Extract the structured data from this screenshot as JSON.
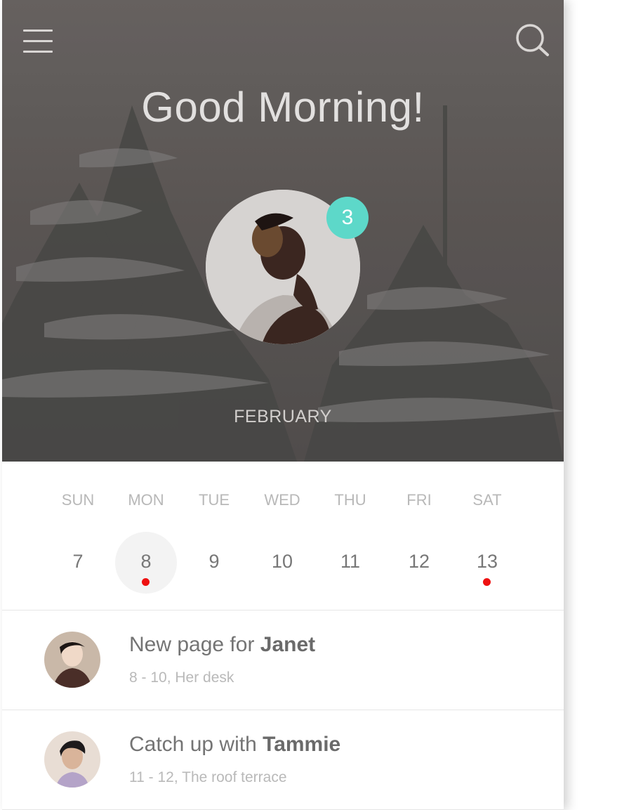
{
  "header": {
    "greeting": "Good Morning!",
    "notification_count": "3",
    "month": "FEBRUARY",
    "menu_icon": "hamburger-menu-icon",
    "search_icon": "search-icon"
  },
  "calendar": {
    "weekdays": [
      "SUN",
      "MON",
      "TUE",
      "WED",
      "THU",
      "FRI",
      "SAT"
    ],
    "days": [
      {
        "num": "7",
        "selected": false,
        "has_event": false
      },
      {
        "num": "8",
        "selected": true,
        "has_event": true
      },
      {
        "num": "9",
        "selected": false,
        "has_event": false
      },
      {
        "num": "10",
        "selected": false,
        "has_event": false
      },
      {
        "num": "11",
        "selected": false,
        "has_event": false
      },
      {
        "num": "12",
        "selected": false,
        "has_event": false
      },
      {
        "num": "13",
        "selected": false,
        "has_event": true
      }
    ]
  },
  "events": [
    {
      "title_prefix": "New page for ",
      "title_name": "Janet",
      "detail": "8 - 10, Her desk"
    },
    {
      "title_prefix": "Catch up with ",
      "title_name": "Tammie",
      "detail": "11 - 12, The roof terrace"
    }
  ],
  "colors": {
    "badge": "#5dd8c9",
    "event_dot": "#ee1111",
    "selected_day_bg": "#f3f3f3"
  }
}
